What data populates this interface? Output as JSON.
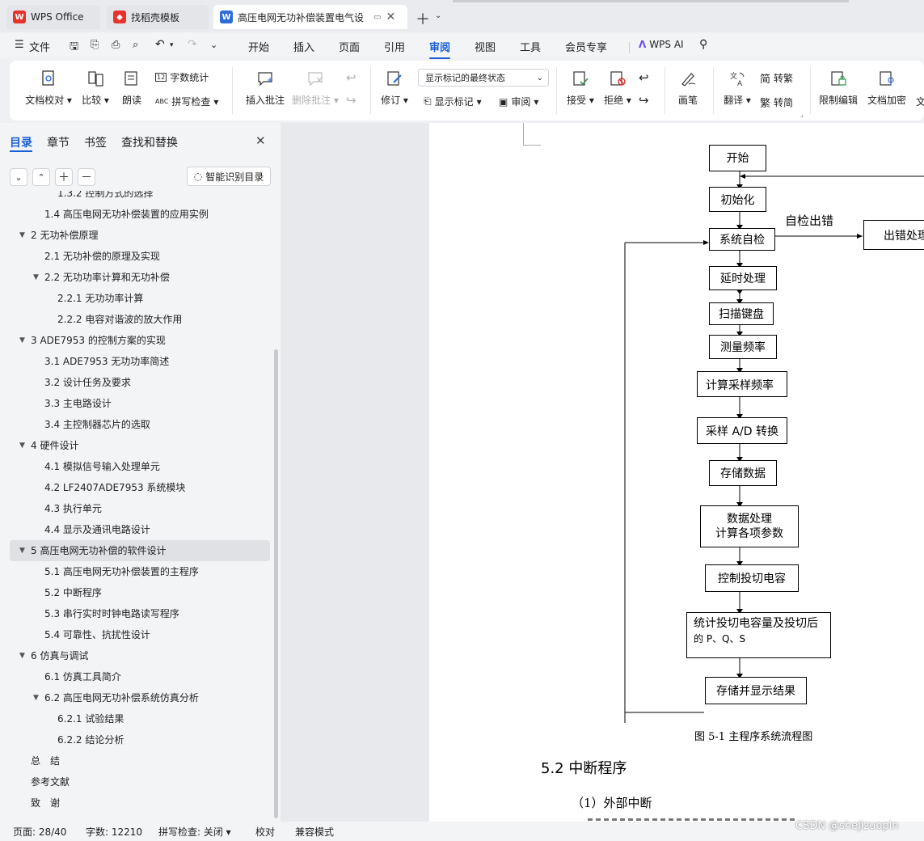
{
  "tabs": [
    {
      "label": "WPS Office",
      "icon": "wps-logo-icon"
    },
    {
      "label": "找稻壳模板",
      "icon": "docer-icon"
    },
    {
      "label": "高压电网无功补偿装置电气设",
      "icon": "writer-icon"
    }
  ],
  "menu": {
    "file": "文件",
    "items": [
      "开始",
      "插入",
      "页面",
      "引用",
      "审阅",
      "视图",
      "工具",
      "会员专享"
    ],
    "active": "审阅",
    "wps_ai": "WPS AI"
  },
  "ribbon": {
    "doc_proof": "文档校对",
    "compare": "比较",
    "read_aloud": "朗读",
    "word_count": "字数统计",
    "spell_check": "拼写检查",
    "insert_comment": "插入批注",
    "delete_comment": "删除批注",
    "track": "修订",
    "markup_state": "显示标记的最终状态",
    "show_markup": "显示标记",
    "review": "审阅",
    "accept": "接受",
    "reject": "拒绝",
    "pen": "画笔",
    "translate": "翻译",
    "to_traditional": "转繁",
    "to_simplified": "转简",
    "restrict_edit": "限制编辑",
    "doc_encrypt": "文档加密",
    "more": "文"
  },
  "panel": {
    "tabs": [
      "目录",
      "章节",
      "书签",
      "查找和替换"
    ],
    "smart_toc": "智能识别目录",
    "toc": [
      {
        "text": "1.3.2 控制方式的选择",
        "level": 3,
        "arrow": ""
      },
      {
        "text": "1.4 高压电网无功补偿装置的应用实例",
        "level": 2,
        "arrow": ""
      },
      {
        "text": "2  无功补偿原理",
        "level": 1,
        "arrow": "▼"
      },
      {
        "text": "2.1 无功补偿的原理及实现",
        "level": 2,
        "arrow": ""
      },
      {
        "text": "2.2 无功功率计算和无功补偿",
        "level": 2,
        "arrow": "▼"
      },
      {
        "text": "2.2.1 无功功率计算",
        "level": 3,
        "arrow": ""
      },
      {
        "text": "2.2.2 电容对谐波的放大作用",
        "level": 3,
        "arrow": ""
      },
      {
        "text": "3 ADE7953 的控制方案的实现",
        "level": 1,
        "arrow": "▼"
      },
      {
        "text": "3.1 ADE7953 无功功率简述",
        "level": 2,
        "arrow": ""
      },
      {
        "text": "3.2 设计任务及要求",
        "level": 2,
        "arrow": ""
      },
      {
        "text": "3.3 主电路设计",
        "level": 2,
        "arrow": ""
      },
      {
        "text": "3.4 主控制器芯片的选取",
        "level": 2,
        "arrow": ""
      },
      {
        "text": "4 硬件设计",
        "level": 1,
        "arrow": "▼"
      },
      {
        "text": "4.1 模拟信号输入处理单元",
        "level": 2,
        "arrow": ""
      },
      {
        "text": "4.2 LF2407ADE7953 系统模块",
        "level": 2,
        "arrow": ""
      },
      {
        "text": "4.3 执行单元",
        "level": 2,
        "arrow": ""
      },
      {
        "text": "4.4 显示及通讯电路设计",
        "level": 2,
        "arrow": ""
      },
      {
        "text": "5 高压电网无功补偿的软件设计",
        "level": 1,
        "arrow": "▼",
        "selected": true
      },
      {
        "text": "5.1 高压电网无功补偿装置的主程序",
        "level": 2,
        "arrow": ""
      },
      {
        "text": "5.2 中断程序",
        "level": 2,
        "arrow": ""
      },
      {
        "text": "5.3 串行实时时钟电路读写程序",
        "level": 2,
        "arrow": ""
      },
      {
        "text": "5.4 可靠性、抗扰性设计",
        "level": 2,
        "arrow": ""
      },
      {
        "text": "6 仿真与调试",
        "level": 1,
        "arrow": "▼"
      },
      {
        "text": "6.1 仿真工具简介",
        "level": 2,
        "arrow": ""
      },
      {
        "text": "6.2 高压电网无功补偿系统仿真分析",
        "level": 2,
        "arrow": "▼"
      },
      {
        "text": "6.2.1 试验结果",
        "level": 3,
        "arrow": ""
      },
      {
        "text": "6.2.2 结论分析",
        "level": 3,
        "arrow": ""
      },
      {
        "text": "总　结",
        "level": 1,
        "arrow": ""
      },
      {
        "text": "参考文献",
        "level": 1,
        "arrow": ""
      },
      {
        "text": "致　谢",
        "level": 1,
        "arrow": ""
      }
    ]
  },
  "flowchart": {
    "start": "开始",
    "init": "初始化",
    "selfcheck": "系统自检",
    "error_label": "自检出错",
    "error_handler": "出错处理",
    "delay": "延时处理",
    "scan": "扫描键盘",
    "freq": "测量频率",
    "sample_freq": "计算采样频率",
    "adc": "采样 A/D 转换",
    "store": "存储数据",
    "process_1": "数据处理",
    "process_2": "计算各项参数",
    "control": "控制投切电容",
    "stats_1": "统计投切电容量及投切后",
    "stats_2": "的 P、Q、S",
    "display": "存储并显示结果",
    "caption": "图 5-1  主程序系统流程图"
  },
  "doc": {
    "heading": "5.2 中断程序",
    "para": "（1）外部中断"
  },
  "status": {
    "page": "页面: 28/40",
    "words": "字数: 12210",
    "spell": "拼写检查: 关闭",
    "proof": "校对",
    "compat": "兼容模式",
    "watermark": "CSDN @shejizuopin"
  }
}
